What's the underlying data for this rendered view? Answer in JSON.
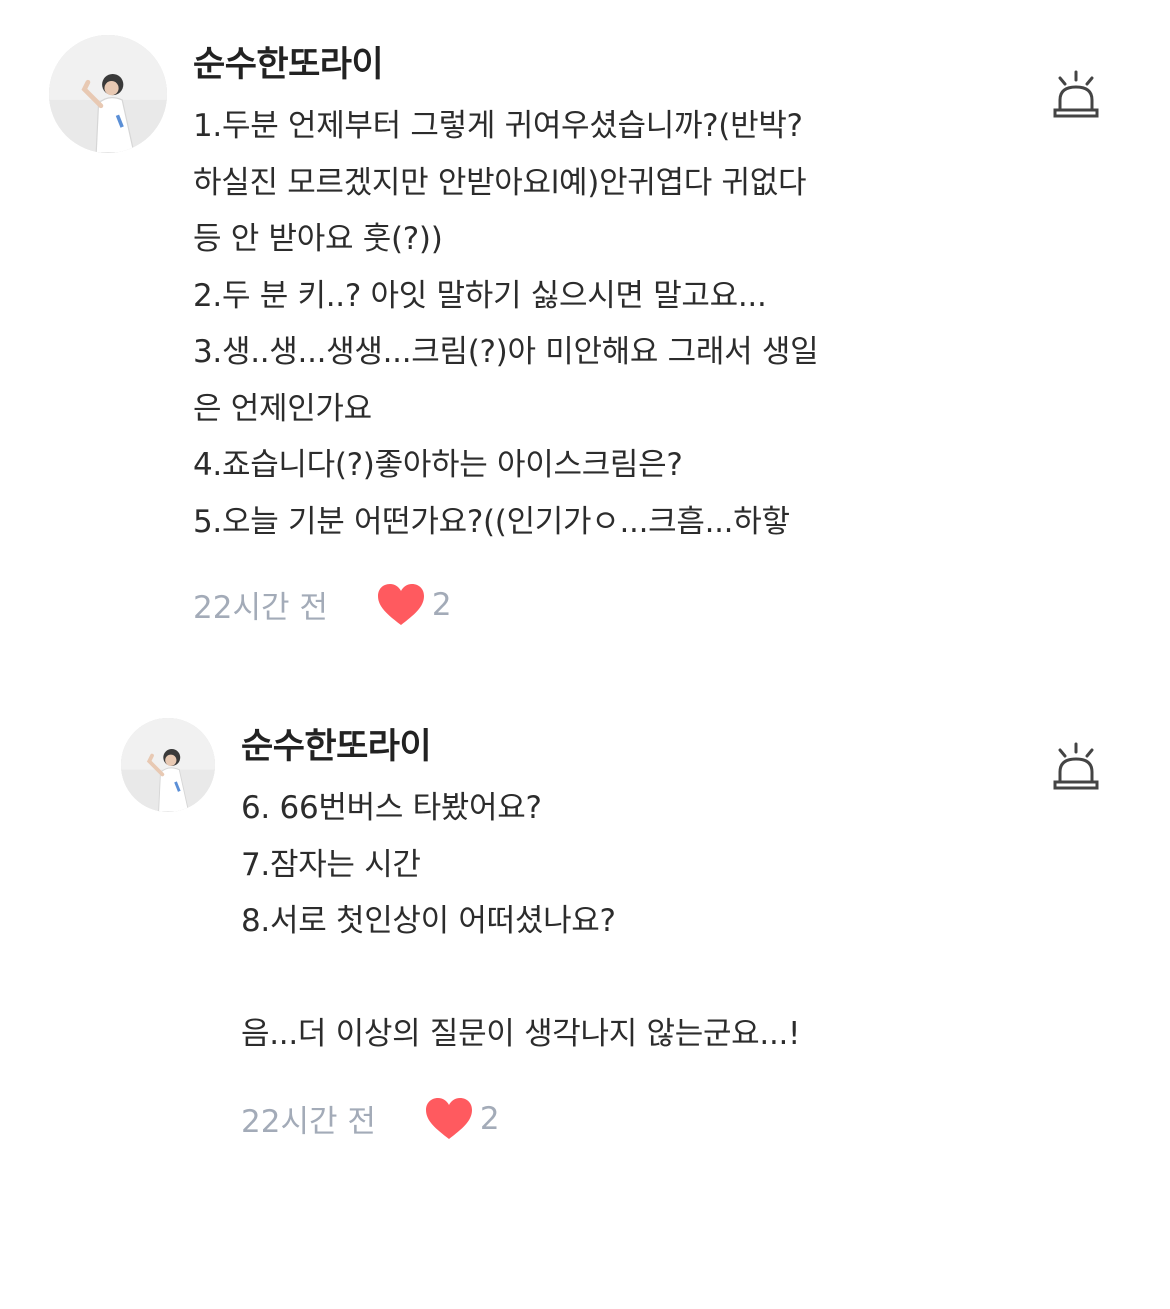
{
  "comments": [
    {
      "username": "순수한또라이",
      "lines": [
        "1.두분 언제부터 그렇게 귀여우셨습니까?(반박?",
        "하실진 모르겠지만 안받아요l예)안귀엽다 귀없다",
        "등 안 받아요 훗(?))",
        "2.두 분 키..? 아잇 말하기 싫으시면 말고요...",
        "3.생..생...생생...크림(?)아 미안해요 그래서 생일",
        "은 언제인가요",
        "4.죠습니다(?)좋아하는 아이스크림은?",
        "5.오늘 기분 어떤가요?((인기가ㅇ...크흠...하핳"
      ],
      "time": "22시간 전",
      "likes": "2",
      "liked": true,
      "like_icon": "heart-icon",
      "report_icon": "siren-report-icon"
    },
    {
      "username": "순수한또라이",
      "lines": [
        "6. 66번버스 타봤어요?",
        "7.잠자는 시간",
        "8.서로 첫인상이 어떠셨나요?",
        "",
        "음...더 이상의 질문이 생각나지 않는군요...!"
      ],
      "time": "22시간 전",
      "likes": "2",
      "liked": true,
      "like_icon": "heart-icon",
      "report_icon": "siren-report-icon"
    }
  ],
  "colors": {
    "heart": "#ff5a5f",
    "meta_text": "#a3abb8",
    "username": "#222222",
    "body_text": "#2c2c2c"
  }
}
